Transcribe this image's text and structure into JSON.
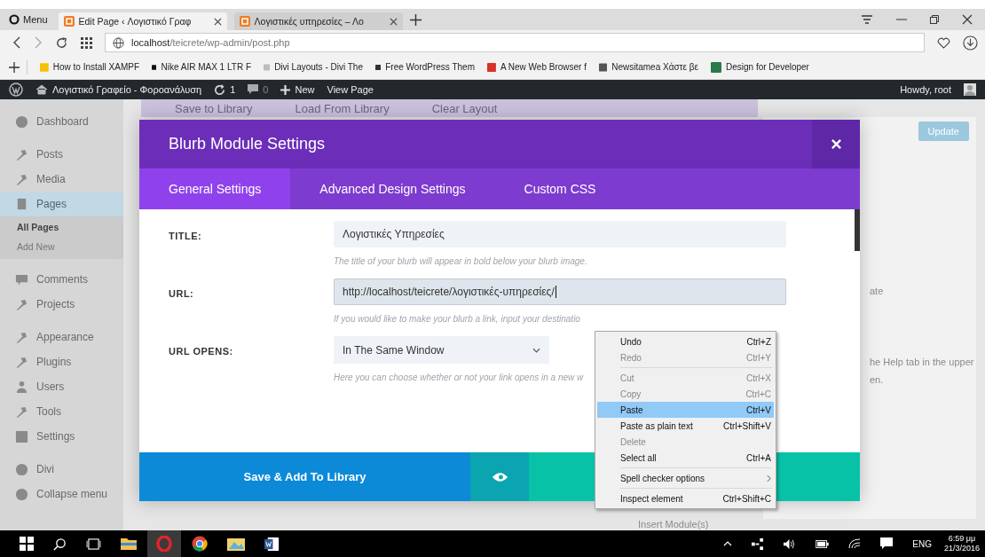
{
  "browser": {
    "menu_label": "Menu",
    "tabs": [
      {
        "title": "Edit Page ‹ Λογιστικό Γραφ",
        "selected": true
      },
      {
        "title": "Λογιστικές υπηρεσίες – Λο",
        "selected": false
      }
    ],
    "address": {
      "host": "localhost",
      "path": "/teicrete/wp-admin/post.php"
    },
    "bookmarks": [
      {
        "title": "How to Install XAMPF",
        "color": "#f2c200"
      },
      {
        "title": "Nike AIR MAX 1 LTR F",
        "color": "#111111"
      },
      {
        "title": "Divi Layouts - Divi The",
        "color": "#bbbbbb"
      },
      {
        "title": "Free WordPress Them",
        "color": "#333333"
      },
      {
        "title": "A New Web Browser f",
        "color": "#d8322b"
      },
      {
        "title": "Newsitamea Χάστε βε",
        "color": "#555555"
      },
      {
        "title": "Design for Developer",
        "color": "#2a7a4a"
      }
    ]
  },
  "admin_bar": {
    "site": "Λογιστικό Γραφείο - Φοροανάλυση",
    "updates": "1",
    "comments": "0",
    "new": "New",
    "view": "View Page",
    "howdy": "Howdy, root"
  },
  "sidebar": {
    "items": [
      {
        "label": "Dashboard",
        "selected": false
      },
      {
        "label": "Posts",
        "selected": false
      },
      {
        "label": "Media",
        "selected": false
      },
      {
        "label": "Pages",
        "selected": true,
        "children": [
          {
            "label": "All Pages",
            "selected": true
          },
          {
            "label": "Add New",
            "selected": false
          }
        ]
      },
      {
        "label": "Comments",
        "selected": false
      },
      {
        "label": "Projects",
        "selected": false
      },
      {
        "label": "Appearance",
        "selected": false
      },
      {
        "label": "Plugins",
        "selected": false
      },
      {
        "label": "Users",
        "selected": false
      },
      {
        "label": "Tools",
        "selected": false
      },
      {
        "label": "Settings",
        "selected": false
      },
      {
        "label": "Divi",
        "selected": false
      },
      {
        "label": "Collapse menu",
        "selected": false
      }
    ]
  },
  "builder_bar": {
    "actions": [
      "Save to Library",
      "Load From Library",
      "Clear Layout"
    ]
  },
  "side_panel": {
    "update": "Update",
    "select_text": "ate",
    "help_lines": [
      "he Help tab in the upper",
      "en."
    ]
  },
  "insert_module": "Insert Module(s)",
  "modal": {
    "title": "Blurb Module Settings",
    "tabs": [
      {
        "label": "General Settings",
        "selected": true
      },
      {
        "label": "Advanced Design Settings",
        "selected": false
      },
      {
        "label": "Custom CSS",
        "selected": false
      }
    ],
    "fields": [
      {
        "label": "TITLE:",
        "kind": "text",
        "value": "Λογιστικές Υπηρεσίες",
        "help": "The title of your blurb will appear in bold below your blurb image.",
        "focused": false
      },
      {
        "label": "URL:",
        "kind": "text",
        "value": "http://localhost/teicrete/λογιστικές-υπηρεσίες/",
        "help": "If you would like to make your blurb a link, input your destinatio",
        "focused": true
      },
      {
        "label": "URL OPENS:",
        "kind": "select",
        "value": "In The Same Window",
        "help": "Here you can choose whether or not your link opens in a new w",
        "focused": false
      }
    ],
    "save_library": "Save & Add To Library"
  },
  "context_menu": [
    {
      "kind": "item",
      "label": "Undo",
      "shortcut": "Ctrl+Z",
      "disabled": false,
      "selected": false
    },
    {
      "kind": "item",
      "label": "Redo",
      "shortcut": "Ctrl+Y",
      "disabled": true,
      "selected": false
    },
    {
      "kind": "separator"
    },
    {
      "kind": "item",
      "label": "Cut",
      "shortcut": "Ctrl+X",
      "disabled": true,
      "selected": false
    },
    {
      "kind": "item",
      "label": "Copy",
      "shortcut": "Ctrl+C",
      "disabled": true,
      "selected": false
    },
    {
      "kind": "item",
      "label": "Paste",
      "shortcut": "Ctrl+V",
      "disabled": false,
      "selected": true
    },
    {
      "kind": "item",
      "label": "Paste as plain text",
      "shortcut": "Ctrl+Shift+V",
      "disabled": false,
      "selected": false
    },
    {
      "kind": "item",
      "label": "Delete",
      "disabled": true,
      "selected": false
    },
    {
      "kind": "item",
      "label": "Select all",
      "shortcut": "Ctrl+A",
      "disabled": false,
      "selected": false
    },
    {
      "kind": "separator"
    },
    {
      "kind": "submenu",
      "label": "Spell checker options",
      "disabled": false,
      "selected": false
    },
    {
      "kind": "separator"
    },
    {
      "kind": "item",
      "label": "Inspect element",
      "shortcut": "Ctrl+Shift+C",
      "disabled": false,
      "selected": false
    }
  ],
  "taskbar": {
    "language": "ENG",
    "time": "6:59 μμ",
    "date": "21/3/2016"
  }
}
